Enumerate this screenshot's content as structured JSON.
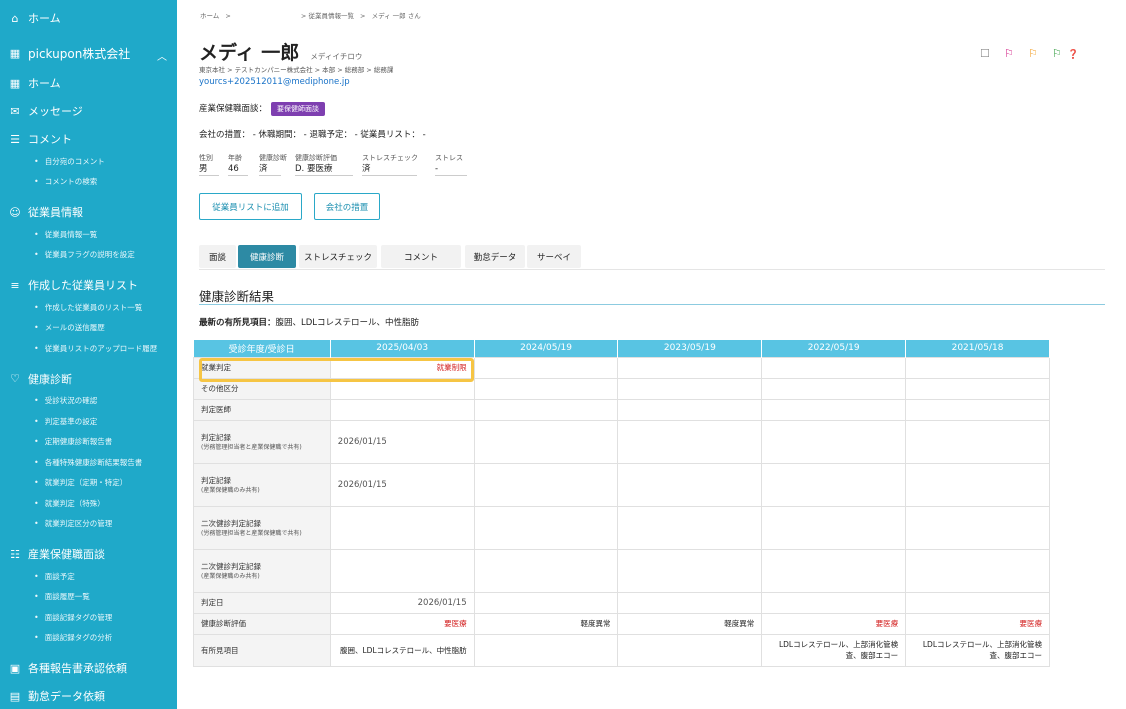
{
  "sidebar": {
    "home": "ホーム",
    "company": "pickupon株式会社",
    "items": [
      {
        "icon": "building-icon",
        "label": "ホーム",
        "sub": []
      },
      {
        "icon": "message-icon",
        "label": "メッセージ",
        "sub": []
      },
      {
        "icon": "comment-icon",
        "label": "コメント",
        "sub": [
          "自分宛のコメント",
          "コメントの検索"
        ]
      },
      {
        "icon": "users-icon",
        "label": "従業員情報",
        "sub": [
          "従業員情報一覧",
          "従業員フラグの説明を設定"
        ]
      },
      {
        "icon": "list-icon",
        "label": "作成した従業員リスト",
        "sub": [
          "作成した従業員のリスト一覧",
          "メールの送信履歴",
          "従業員リストのアップロード履歴"
        ]
      },
      {
        "icon": "stethoscope-icon",
        "label": "健康診断",
        "sub": [
          "受診状況の確認",
          "判定基準の設定",
          "定期健康診断報告書",
          "各種特殊健康診断結果報告書",
          "就業判定（定期・特定）",
          "就業判定（特殊）",
          "就業判定区分の管理"
        ]
      },
      {
        "icon": "interview-icon",
        "label": "産業保健職面談",
        "sub": [
          "面談予定",
          "面談履歴一覧",
          "面談記録タグの管理",
          "面談記録タグの分析"
        ]
      },
      {
        "icon": "document-check-icon",
        "label": "各種報告書承認依頼",
        "sub": []
      },
      {
        "icon": "calendar-icon",
        "label": "勤怠データ依頼",
        "sub": []
      }
    ]
  },
  "breadcrumb": {
    "home": "ホーム",
    "sep": ">",
    "list": "従業員情報一覧",
    "current": "メディ 一郎 さん"
  },
  "employee": {
    "name": "メディ 一郎",
    "kana": "メディイチロウ",
    "org": "東京本社 > テストカンパニー株式会社 > 本部 > 総務部 > 総務課",
    "email": "yourcs+202512011@mediphone.jp",
    "interview_label": "産業保健職面談：",
    "interview_badge": "要保健師面談",
    "measures": "会社の措置： - 休職期間： - 退職予定： - 従業員リスト： -",
    "fields": [
      {
        "label": "性別",
        "value": "男"
      },
      {
        "label": "年齢",
        "value": "46"
      },
      {
        "label": "健康診断",
        "value": "済"
      },
      {
        "label": "健康診断評価",
        "value": "D. 要医療"
      },
      {
        "label": "ストレスチェック",
        "value": "済"
      },
      {
        "label": "ストレス",
        "value": "-"
      }
    ]
  },
  "buttons": {
    "add_list": "従業員リストに追加",
    "company_measure": "会社の措置"
  },
  "header_icons": [
    "bookmark-icon",
    "flag-magenta-icon",
    "flag-orange-icon",
    "flag-green-icon",
    "help-icon"
  ],
  "colors": {
    "sidebar": "#1fa9c9",
    "accent": "#2d8aa4",
    "badge": "#7e3fb0",
    "alert": "#d32121",
    "table_header": "#58c4e3",
    "highlight": "#f6c544"
  },
  "tabs": [
    "面談",
    "健康診断",
    "ストレスチェック",
    "コメント",
    "勤怠データ",
    "サーベイ"
  ],
  "active_tab": "健康診断",
  "section": {
    "title": "健康診断結果",
    "finding_label": "最新の有所見項目：",
    "finding_value": "腹囲、LDLコレステロール、中性脂肪"
  },
  "table": {
    "headers": [
      "受診年度/受診日",
      "2025/04/03",
      "2024/05/19",
      "2023/05/19",
      "2022/05/19",
      "2021/05/18"
    ],
    "rows": [
      {
        "label": "就業判定",
        "sub": "",
        "cells": [
          "就業制限",
          "",
          "",
          "",
          ""
        ]
      },
      {
        "label": "その他区分",
        "sub": "",
        "cells": [
          "",
          "",
          "",
          "",
          ""
        ]
      },
      {
        "label": "判定医師",
        "sub": "",
        "cells": [
          "",
          "",
          "",
          "",
          ""
        ]
      },
      {
        "label": "判定記録",
        "sub": "(労務管理担当者と産業保健職で共有)",
        "cells": [
          "2026/01/15",
          "",
          "",
          "",
          ""
        ]
      },
      {
        "label": "判定記録",
        "sub": "(産業保健職のみ共有)",
        "cells": [
          "2026/01/15",
          "",
          "",
          "",
          ""
        ]
      },
      {
        "label": "二次健診判定記録",
        "sub": "(労務管理担当者と産業保健職で共有)",
        "cells": [
          "",
          "",
          "",
          "",
          ""
        ]
      },
      {
        "label": "二次健診判定記録",
        "sub": "(産業保健職のみ共有)",
        "cells": [
          "",
          "",
          "",
          "",
          ""
        ]
      },
      {
        "label": "判定日",
        "sub": "",
        "cells": [
          "2026/01/15",
          "",
          "",
          "",
          ""
        ]
      },
      {
        "label": "健康診断評価",
        "sub": "",
        "cells": [
          "要医療",
          "軽度異常",
          "軽度異常",
          "要医療",
          "要医療"
        ]
      },
      {
        "label": "有所見項目",
        "sub": "",
        "cells": [
          "腹囲、LDLコレステロール、中性脂肪",
          "",
          "",
          "LDLコレステロール、上部消化管検査、腹部エコー",
          "LDLコレステロール、上部消化管検査、腹部エコー"
        ]
      }
    ]
  }
}
